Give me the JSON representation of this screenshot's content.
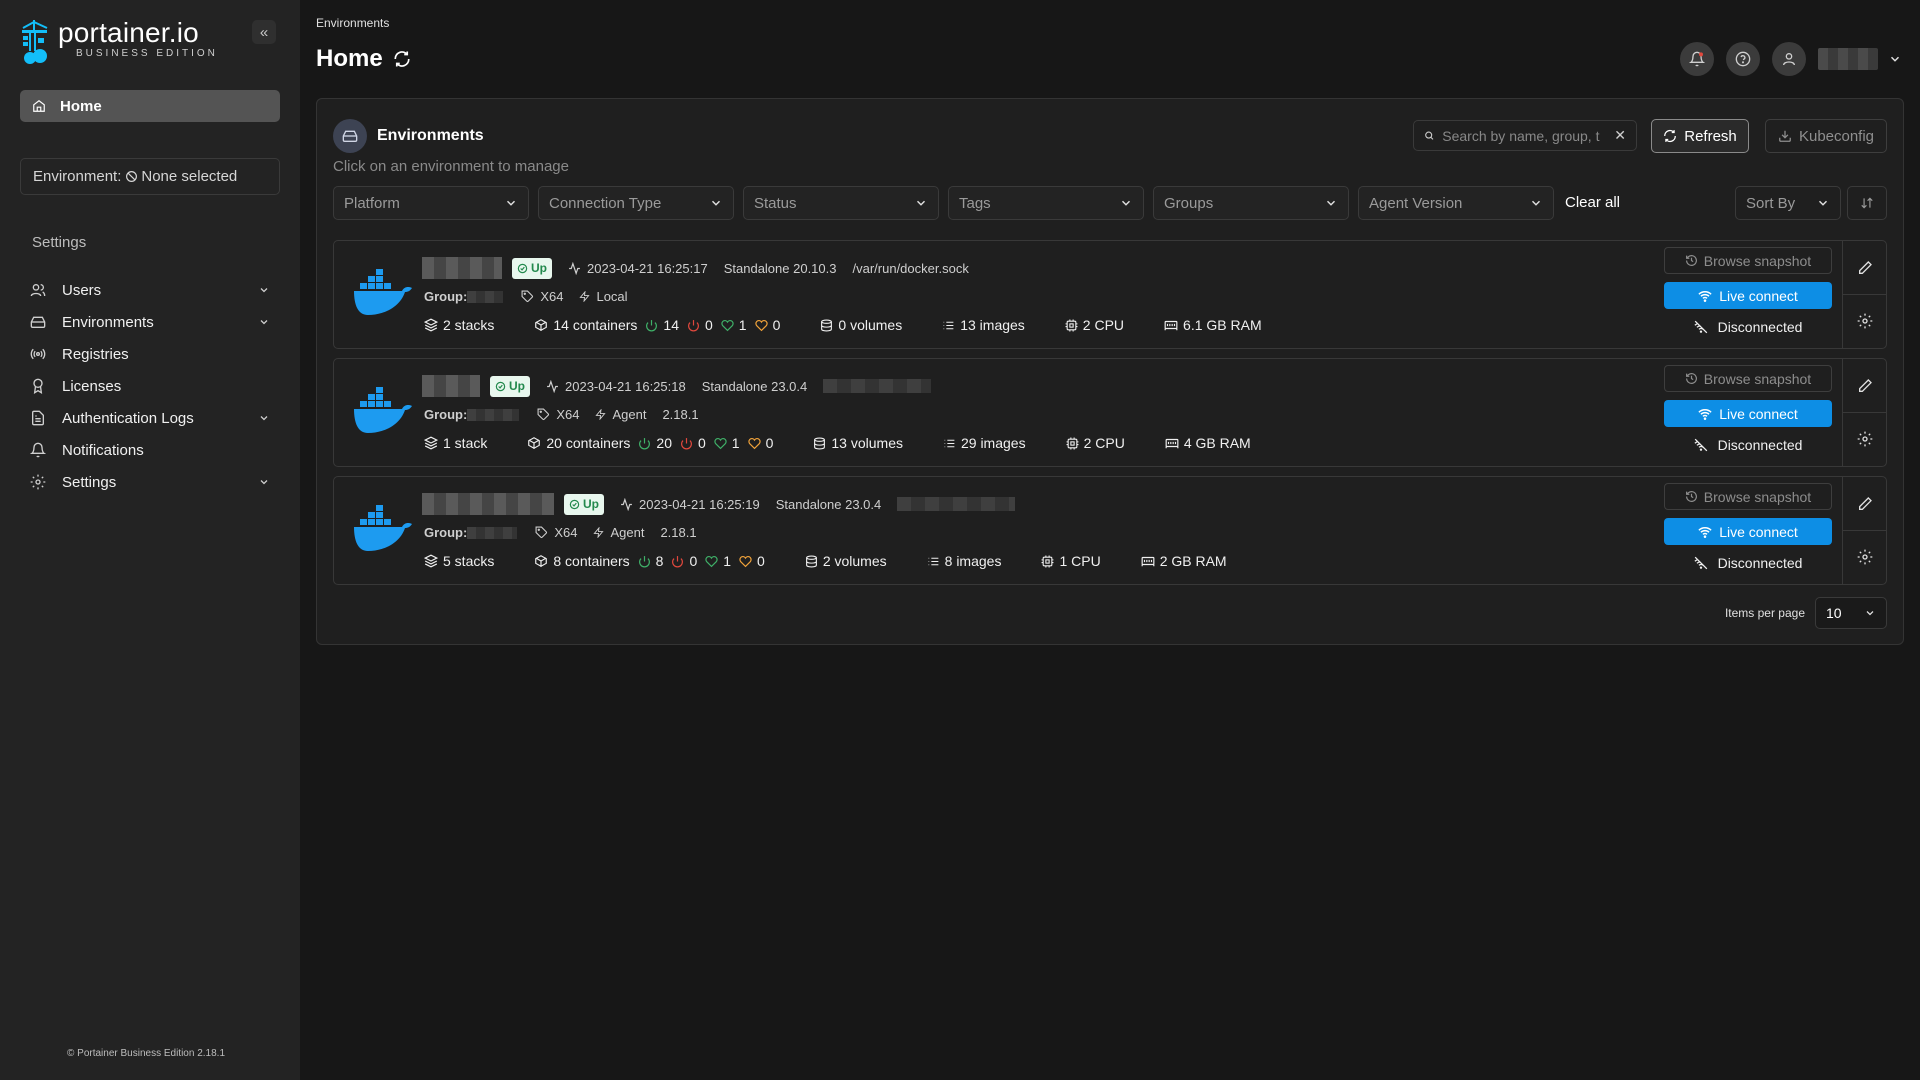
{
  "app": {
    "logo_text": "portainer.io",
    "logo_sub": "BUSINESS EDITION",
    "footer": "© Portainer Business Edition 2.18.1"
  },
  "sidebar": {
    "home_label": "Home",
    "environment_prefix": "Environment:",
    "environment_value": "None selected",
    "settings_heading": "Settings",
    "items": [
      {
        "label": "Users",
        "icon": "users-icon",
        "expandable": true
      },
      {
        "label": "Environments",
        "icon": "hard-drive-icon",
        "expandable": true
      },
      {
        "label": "Registries",
        "icon": "radio-icon",
        "expandable": false
      },
      {
        "label": "Licenses",
        "icon": "award-icon",
        "expandable": false
      },
      {
        "label": "Authentication Logs",
        "icon": "file-text-icon",
        "expandable": true
      },
      {
        "label": "Notifications",
        "icon": "bell-icon",
        "expandable": false
      },
      {
        "label": "Settings",
        "icon": "gear-icon",
        "expandable": true
      }
    ]
  },
  "header": {
    "breadcrumb": "Environments",
    "title": "Home"
  },
  "panel": {
    "title": "Environments",
    "subtitle": "Click on an environment to manage",
    "search_placeholder": "Search by name, group, t",
    "refresh_label": "Refresh",
    "kubeconfig_label": "Kubeconfig",
    "filters": [
      "Platform",
      "Connection Type",
      "Status",
      "Tags",
      "Groups",
      "Agent Version"
    ],
    "clear_all": "Clear all",
    "sort_by": "Sort By"
  },
  "environments": [
    {
      "status": "Up",
      "heartbeat": "2023-04-21 16:25:17",
      "platform": "Standalone 20.10.3",
      "url": "/var/run/docker.sock",
      "group_label": "Group:",
      "arch": "X64",
      "conn_type": "Local",
      "agent_version": "",
      "stacks": "2 stacks",
      "containers": "14 containers",
      "running": "14",
      "stopped": "0",
      "healthy": "1",
      "unhealthy": "0",
      "volumes": "0 volumes",
      "images": "13 images",
      "cpu": "2 CPU",
      "ram": "6.1 GB RAM"
    },
    {
      "status": "Up",
      "heartbeat": "2023-04-21 16:25:18",
      "platform": "Standalone 23.0.4",
      "url": "",
      "group_label": "Group:",
      "arch": "X64",
      "conn_type": "Agent",
      "agent_version": "2.18.1",
      "stacks": "1 stack",
      "containers": "20 containers",
      "running": "20",
      "stopped": "0",
      "healthy": "1",
      "unhealthy": "0",
      "volumes": "13 volumes",
      "images": "29 images",
      "cpu": "2 CPU",
      "ram": "4 GB RAM"
    },
    {
      "status": "Up",
      "heartbeat": "2023-04-21 16:25:19",
      "platform": "Standalone 23.0.4",
      "url": "",
      "group_label": "Group:",
      "arch": "X64",
      "conn_type": "Agent",
      "agent_version": "2.18.1",
      "stacks": "5 stacks",
      "containers": "8 containers",
      "running": "8",
      "stopped": "0",
      "healthy": "1",
      "unhealthy": "0",
      "volumes": "2 volumes",
      "images": "8 images",
      "cpu": "1 CPU",
      "ram": "2 GB RAM"
    }
  ],
  "card_actions": {
    "browse_snapshot": "Browse snapshot",
    "live_connect": "Live connect",
    "disconnected": "Disconnected"
  },
  "pagination": {
    "items_per_page_label": "Items per page",
    "items_per_page_value": "10"
  },
  "colors": {
    "accent": "#0d8ee5",
    "status_up_bg": "#e8f7ee",
    "status_up_text": "#23894d",
    "running": "#3fb068",
    "stopped": "#e0483d",
    "unhealthy": "#f0a23a"
  }
}
